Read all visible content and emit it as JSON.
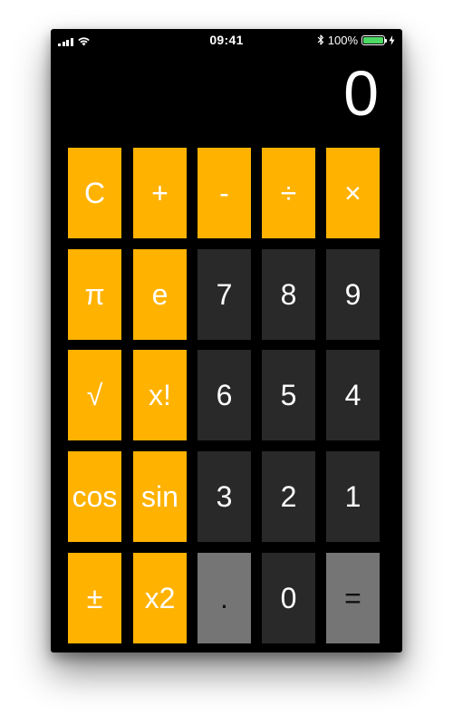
{
  "status_bar": {
    "time": "09:41",
    "battery_percent": "100%",
    "battery_color": "#4cd964"
  },
  "display": {
    "value": "0"
  },
  "keys": {
    "clear": "C",
    "add": "+",
    "subtract": "-",
    "divide": "÷",
    "multiply": "×",
    "pi": "π",
    "e": "e",
    "seven": "7",
    "eight": "8",
    "nine": "9",
    "sqrt": "√",
    "factorial": "x!",
    "six": "6",
    "five": "5",
    "four": "4",
    "cos": "cos",
    "sin": "sin",
    "three": "3",
    "two": "2",
    "one": "1",
    "plus_minus": "±",
    "square": "x2",
    "decimal": ".",
    "zero": "0",
    "equals": "="
  },
  "colors": {
    "operator_key": "#ffb200",
    "number_key": "#292929",
    "light_key": "#757575",
    "background": "#000000"
  }
}
